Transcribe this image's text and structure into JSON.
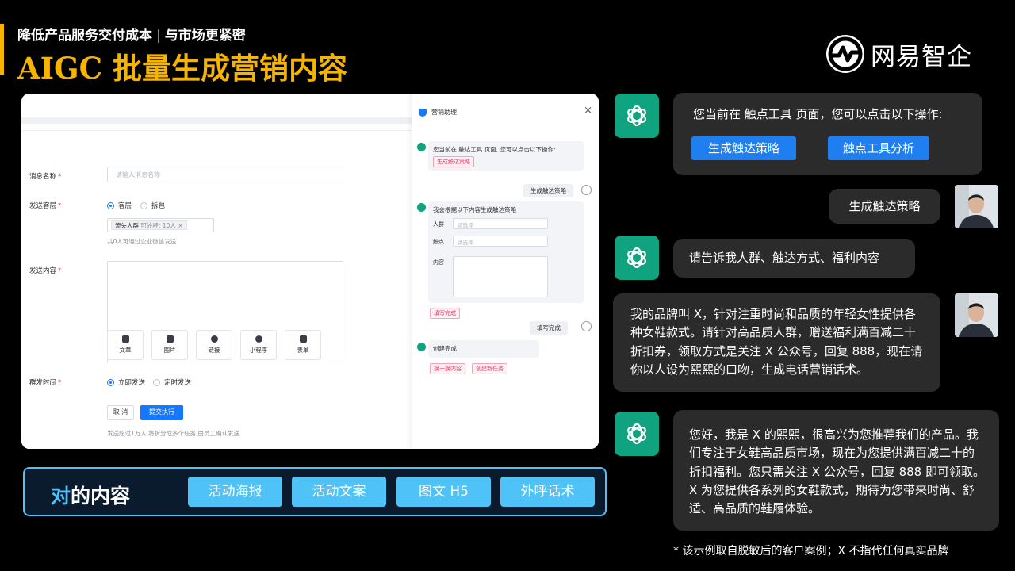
{
  "header": {
    "subtitle_left": "降低产品服务交付成本",
    "subtitle_sep": "|",
    "subtitle_right": "与市场更紧密",
    "title": "AIGC  批量生成营销内容",
    "logo_text": "网易智企"
  },
  "screenshot": {
    "form": {
      "name_label": "消息名称",
      "name_placeholder": "请输入消息名称",
      "target_label": "发送客层",
      "target_option_1": "客层",
      "target_option_2": "拆包",
      "tag_name": "流失人群",
      "tag_detail": "可外呼: 10人",
      "tag_close": "×",
      "target_hint": "共0人可通过企业微信发送",
      "content_label": "发送内容",
      "tiles": [
        {
          "label": "文章",
          "icon": "article-icon"
        },
        {
          "label": "图片",
          "icon": "image-icon"
        },
        {
          "label": "链接",
          "icon": "link-icon"
        },
        {
          "label": "小程序",
          "icon": "miniprogram-icon"
        },
        {
          "label": "表单",
          "icon": "form-icon"
        }
      ],
      "time_label": "群发时间",
      "time_option_1": "立即发送",
      "time_option_2": "定时发送",
      "cancel": "取 消",
      "submit": "提交执行",
      "footer_hint": "发送超过1万人,将拆分成多个任务,由员工确认发送"
    },
    "assistant": {
      "title": "营销助理",
      "close": "×",
      "msg1": "您当前在 触达工具 页面, 您可以点击以下操作:",
      "chip1": "生成触达策略",
      "user1": "生成触达策略",
      "msg2": "我会根据以下内容生成触达策略",
      "field_crowd": "人群",
      "field_touch": "触点",
      "field_content": "内容",
      "select_placeholder": "请选择",
      "chip2": "填写完成",
      "user2": "填写完成",
      "msg3": "创建完成",
      "chip3": "换一换内容",
      "chip4": "创建新任务"
    }
  },
  "content_bar": {
    "label_highlight": "对",
    "label_rest": "的内容",
    "chips": [
      "活动海报",
      "活动文案",
      "图文 H5",
      "外呼话术"
    ]
  },
  "chat": {
    "bot1": "您当前在 触点工具 页面，您可以点击以下操作:",
    "bot1_btn1": "生成触达策略",
    "bot1_btn2": "触点工具分析",
    "user1": "生成触达策略",
    "bot2": "请告诉我人群、触达方式、福利内容",
    "user2": "我的品牌叫 X，针对注重时尚和品质的年轻女性提供各种女鞋款式。请针对高品质人群，赠送福利满百减二十折扣券，领取方式是关注 X 公众号，回复 888，现在请你以人设为熙熙的口吻，生成电话营销话术。",
    "bot3": "您好，我是 X 的熙熙，很高兴为您推荐我们的产品。我们专注于女鞋高品质市场，现在为您提供满百减二十的折扣福利。您只需关注 X 公众号，回复 888 即可领取。X 为您提供各系列的女鞋款式，期待为您带来时尚、舒适、高品质的鞋履体验。"
  },
  "footnote": "*  该示例取自脱敏后的客户案例；X  不指代任何真实品牌",
  "colors": {
    "accent": "#f5b400",
    "bot_green": "#10a37f",
    "button_blue": "#1f7ef0",
    "chip_cyan": "#4fc3f7",
    "bubble_bg": "#2b2b2b"
  }
}
